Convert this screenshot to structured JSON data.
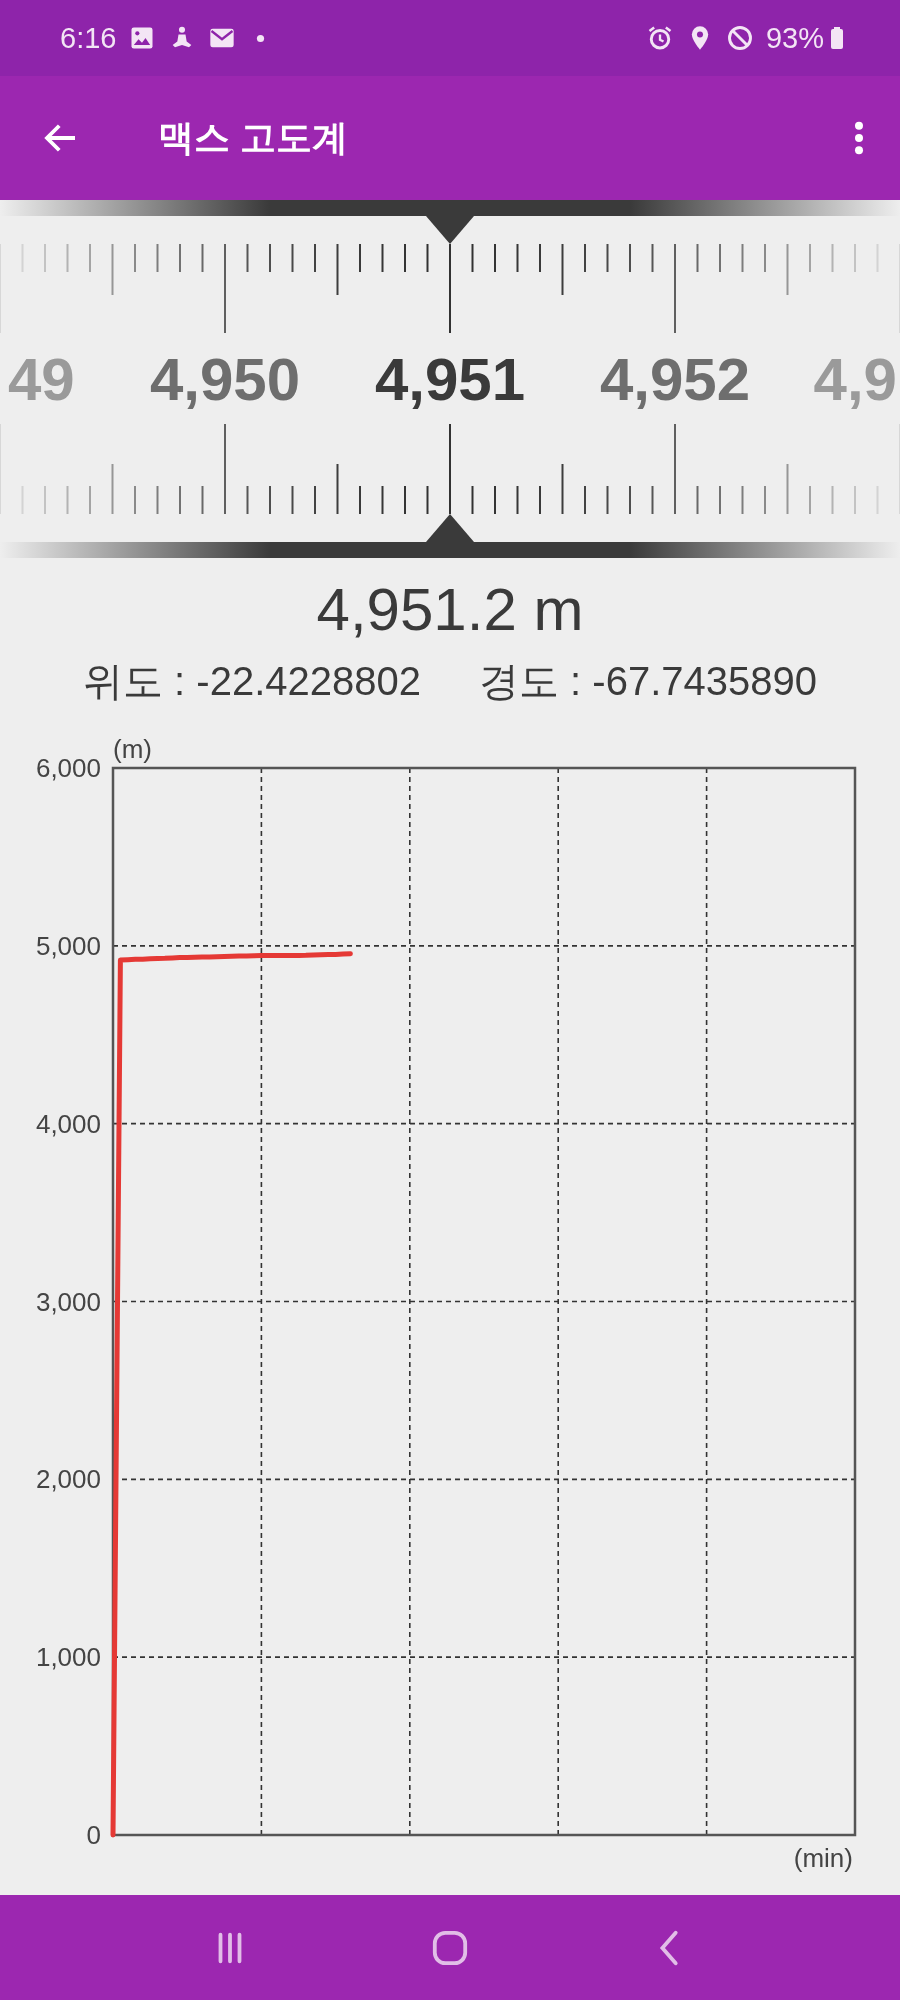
{
  "status_bar": {
    "time": "6:16",
    "battery": "93%"
  },
  "app_bar": {
    "title": "맥스 고도계"
  },
  "ruler": {
    "labels": [
      "49",
      "4,950",
      "4,951",
      "4,952",
      "4,9"
    ]
  },
  "reading": {
    "altitude": "4,951.2 m",
    "latitude": "위도 : -22.4228802",
    "longitude": "경도 : -67.7435890"
  },
  "chart": {
    "chart_data": {
      "type": "line",
      "grid": true,
      "xlabel": "(min)",
      "ylabel": "(m)",
      "ylim": [
        0,
        6000
      ],
      "yticks": [
        {
          "value": 0,
          "label": "0"
        },
        {
          "value": 1000,
          "label": "1,000"
        },
        {
          "value": 2000,
          "label": "2,000"
        },
        {
          "value": 3000,
          "label": "3,000"
        },
        {
          "value": 4000,
          "label": "4,000"
        },
        {
          "value": 5000,
          "label": "5,000"
        },
        {
          "value": 6000,
          "label": "6,000"
        }
      ],
      "categories": [
        null,
        null,
        null,
        null,
        null,
        null,
        null,
        null,
        null,
        null,
        null,
        null,
        null,
        null,
        null,
        null,
        null,
        null,
        null,
        null,
        null,
        null,
        null,
        null,
        null,
        null,
        null,
        null,
        null,
        null,
        null,
        null,
        null,
        null,
        null,
        null,
        null,
        null,
        null,
        null,
        null,
        null,
        null,
        null,
        null,
        null,
        null,
        null,
        null,
        null,
        null,
        null,
        null,
        null,
        null,
        null,
        null,
        null,
        null,
        null,
        null,
        null,
        null,
        null,
        null,
        null,
        null,
        null,
        null,
        null,
        null,
        null,
        null,
        null,
        null,
        null,
        null,
        null,
        null,
        null,
        null,
        null,
        null,
        null,
        null,
        null,
        null,
        null,
        null,
        null,
        null,
        null,
        null,
        null,
        null,
        null,
        null,
        null,
        null,
        null,
        null
      ],
      "values": [
        0,
        4920,
        4922,
        4924,
        4925,
        4927,
        4929,
        4930,
        4932,
        4934,
        4935,
        4936,
        4937,
        4938,
        4939,
        4940,
        4941,
        4942,
        4943,
        4944,
        4945,
        4945,
        4945,
        4945,
        4945,
        4946,
        4947,
        4949,
        4950,
        4951,
        4952,
        4954,
        4955,
        null,
        null,
        null,
        null,
        null,
        null,
        null,
        null,
        null,
        null,
        null,
        null,
        null,
        null,
        null,
        null,
        null,
        null,
        null,
        null,
        null,
        null,
        null,
        null,
        null,
        null,
        null,
        null,
        null,
        null,
        null,
        null,
        null,
        null,
        null,
        null,
        null,
        null,
        null,
        null,
        null,
        null,
        null,
        null,
        null,
        null,
        null,
        null,
        null,
        null,
        null,
        null,
        null,
        null,
        null,
        null,
        null,
        null,
        null,
        null,
        null,
        null,
        null,
        null,
        null,
        null,
        null,
        null
      ]
    }
  }
}
